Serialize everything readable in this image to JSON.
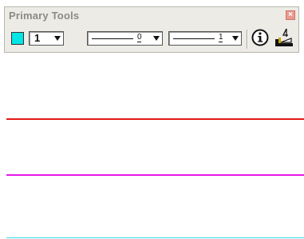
{
  "window": {
    "title": "Primary Tools",
    "close_glyph": "×"
  },
  "tools": {
    "active_color": "#00e5e5",
    "level_value": "1",
    "line_style_value": "0",
    "line_weight_value": "1",
    "info_icon": "info-circle-icon",
    "place_icon": "place-line-tool-icon"
  },
  "canvas": {
    "lines": [
      {
        "name": "red-line",
        "color": "#e31b17"
      },
      {
        "name": "magenta-line",
        "color": "#e619e6"
      },
      {
        "name": "cyan-line",
        "color": "#33d9e6"
      }
    ]
  }
}
